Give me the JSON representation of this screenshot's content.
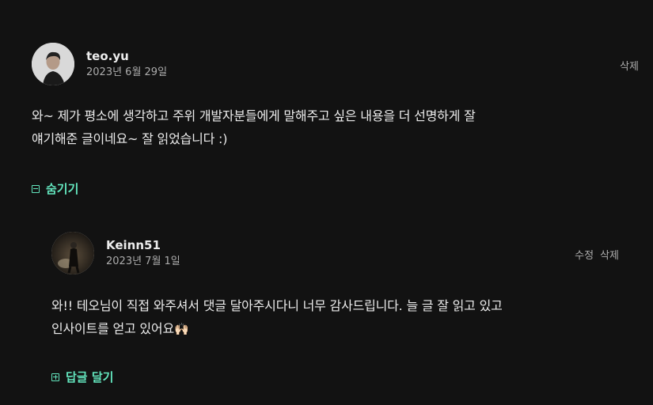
{
  "comment": {
    "username": "teo.yu",
    "date": "2023년 6월 29일",
    "delete_label": "삭제",
    "lines": [
      "와~ 제가 평소에 생각하고 주위 개발자분들에게 말해주고 싶은 내용을 더 선명하게 잘",
      "얘기해준 글이네요~ 잘 읽었습니다 :)"
    ],
    "toggle_label": "숨기기"
  },
  "reply": {
    "username": "Keinn51",
    "date": "2023년 7월 1일",
    "edit_label": "수정",
    "delete_label": "삭제",
    "lines": [
      "와!! 테오님이 직접 와주셔서 댓글 달아주시다니 너무 감사드립니다. 늘 글 잘 읽고 있고",
      "인사이트를 얻고 있어요"
    ],
    "emoji": "🙌🏻",
    "reply_button_label": "답글 달기"
  },
  "colors": {
    "background": "#121212",
    "text": "#ececec",
    "muted": "#acacac",
    "accent": "#63e6be"
  }
}
